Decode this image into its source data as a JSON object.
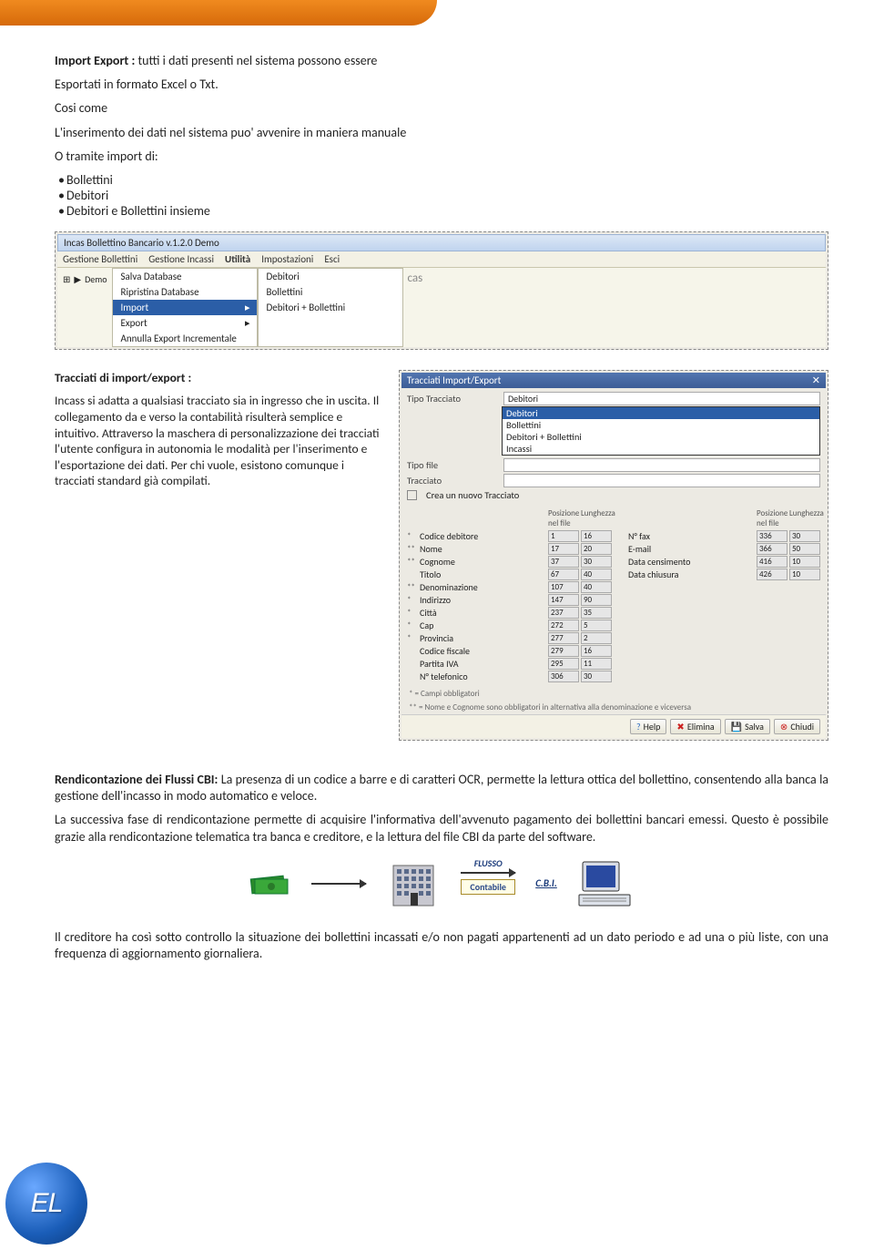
{
  "intro": {
    "title": "Import Export :",
    "text1": " tutti i dati presenti nel sistema possono essere",
    "text2": "Esportati in formato Excel o Txt.",
    "text3": "Cosi come",
    "text4": "L'inserimento dei dati nel sistema puo' avvenire in maniera manuale",
    "text5": "O tramite import di:",
    "bullets": [
      "Bollettini",
      "Debitori",
      "Debitori e Bollettini insieme"
    ]
  },
  "screenshot1": {
    "title": "Incas Bollettino Bancario v.1.2.0 Demo",
    "menu": [
      "Gestione Bollettini",
      "Gestione Incassi",
      "Utilità",
      "Impostazioni",
      "Esci"
    ],
    "dropdown1": [
      "Salva Database",
      "Ripristina Database",
      "Import",
      "Export",
      "Annulla Export Incrementale"
    ],
    "dropdown1_hl": "Import",
    "dropdown2": [
      "Debitori",
      "Bollettini",
      "Debitori + Bollettini"
    ],
    "tree_item": "Demo"
  },
  "tracciati_text": {
    "title": "Tracciati di import/export :",
    "body": "Incass si adatta a qualsiasi tracciato sia in ingresso che in uscita. Il collegamento da e verso la contabilità risulterà semplice e intuitivo. Attraverso la maschera di personalizzazione dei tracciati l'utente configura in autonomia le modalità per l'inserimento e l'esportazione dei dati. Per chi vuole, esistono comunque i tracciati standard già compilati."
  },
  "tracciati_win": {
    "title": "Tracciati Import/Export",
    "rows": [
      {
        "label": "Tipo Tracciato",
        "value": "Debitori"
      },
      {
        "label": "Tipo file",
        "value": ""
      },
      {
        "label": "Tracciato",
        "value": ""
      }
    ],
    "dropdown_options": [
      "Debitori",
      "Bollettini",
      "Debitori + Bollettini",
      "Incassi"
    ],
    "dropdown_hl": "Debitori",
    "checkbox_label": "Crea un nuovo Tracciato",
    "grid_header_left": [
      "",
      "Posizione nel file",
      "Lunghezza"
    ],
    "grid_header_right": [
      "",
      "Posizione nel file",
      "Lunghezza"
    ],
    "left_rows": [
      {
        "star": "*",
        "name": "Codice debitore",
        "pos": "1",
        "len": "16"
      },
      {
        "star": "**",
        "name": "Nome",
        "pos": "17",
        "len": "20"
      },
      {
        "star": "**",
        "name": "Cognome",
        "pos": "37",
        "len": "30"
      },
      {
        "star": "",
        "name": "Titolo",
        "pos": "67",
        "len": "40"
      },
      {
        "star": "**",
        "name": "Denominazione",
        "pos": "107",
        "len": "40"
      },
      {
        "star": "*",
        "name": "Indirizzo",
        "pos": "147",
        "len": "90"
      },
      {
        "star": "*",
        "name": "Città",
        "pos": "237",
        "len": "35"
      },
      {
        "star": "*",
        "name": "Cap",
        "pos": "272",
        "len": "5"
      },
      {
        "star": "*",
        "name": "Provincia",
        "pos": "277",
        "len": "2"
      },
      {
        "star": "",
        "name": "Codice fiscale",
        "pos": "279",
        "len": "16"
      },
      {
        "star": "",
        "name": "Partita IVA",
        "pos": "295",
        "len": "11"
      },
      {
        "star": "",
        "name": "N° telefonico",
        "pos": "306",
        "len": "30"
      }
    ],
    "right_rows": [
      {
        "star": "",
        "name": "N° fax",
        "pos": "336",
        "len": "30"
      },
      {
        "star": "",
        "name": "E-mail",
        "pos": "366",
        "len": "50"
      },
      {
        "star": "",
        "name": "Data censimento",
        "pos": "416",
        "len": "10"
      },
      {
        "star": "",
        "name": "Data chiusura",
        "pos": "426",
        "len": "10"
      }
    ],
    "footnote1": "* = Campi obbligatori",
    "footnote2": "** = Nome e Cognome sono obbligatori in alternativa alla denominazione e viceversa",
    "buttons": {
      "help": "Help",
      "elimina": "Elimina",
      "salva": "Salva",
      "chiudi": "Chiudi"
    }
  },
  "rendicontazione": {
    "title": "Rendicontazione dei Flussi CBI:",
    "p1": " La presenza di un codice a barre e di caratteri OCR, permette la lettura ottica del bollettino, consentendo alla banca la gestione dell'incasso in modo automatico e veloce.",
    "p2": "La successiva fase di rendicontazione permette di acquisire l'informativa dell'avvenuto pagamento dei bollettini bancari emessi. Questo è possibile grazie alla rendicontazione telematica tra banca e creditore, e la lettura del file CBI da parte del software.",
    "flow": {
      "flusso": "FLUSSO",
      "cbi": "C.B.I.",
      "contabile": "Contabile"
    },
    "p3": "Il creditore ha così sotto controllo la situazione dei bollettini incassati e/o non pagati appartenenti ad un dato periodo e ad una o più liste, con una frequenza di aggiornamento giornaliera."
  },
  "logo": "EL"
}
